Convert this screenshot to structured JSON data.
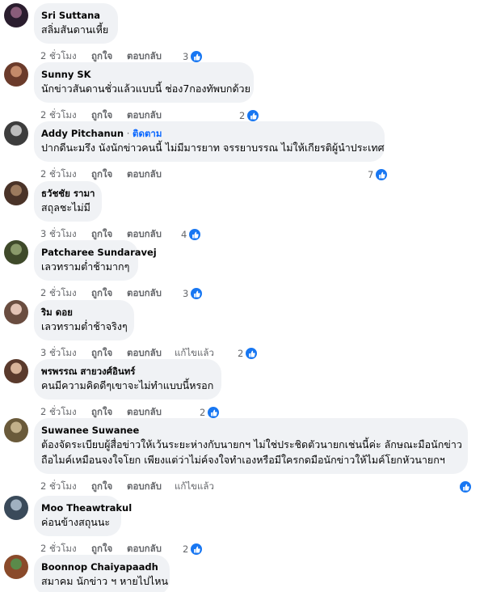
{
  "icons": {
    "like": "thumbs-up-icon"
  },
  "colors": {
    "bubble": "#f0f2f5",
    "accent": "#0866ff",
    "meta": "#65676b",
    "like": "#1877f2"
  },
  "comments": [
    {
      "author": "Sri Suttana",
      "text": [
        "สลิ่มสันดานเหี้ย"
      ],
      "time": "2 ชั่วโมง",
      "like": "ถูกใจ",
      "reply": "ตอบกลับ",
      "edited": "",
      "reactions": "3",
      "follow": ""
    },
    {
      "author": "Sunny SK",
      "text": [
        "นักข่าวสันดานชั่วแล้วแบบนี้ ช่อง7กองทัพบกด้วย"
      ],
      "time": "2 ชั่วโมง",
      "like": "ถูกใจ",
      "reply": "ตอบกลับ",
      "edited": "",
      "reactions": "2",
      "follow": ""
    },
    {
      "author": "Addy Pitchanun",
      "follow": "ติดตาม",
      "text": [
        "ปากดีนะมรึง นังนักข่าวคนนี้ ไม่มีมารยาท จรรยาบรรณ ไม่ให้เกียรติผู้นำประเทศ"
      ],
      "time": "2 ชั่วโมง",
      "like": "ถูกใจ",
      "reply": "ตอบกลับ",
      "edited": "",
      "reactions": "7"
    },
    {
      "author": "ธวัชชัย รามา",
      "text": [
        "สถุลชะไม่มี"
      ],
      "time": "3 ชั่วโมง",
      "like": "ถูกใจ",
      "reply": "ตอบกลับ",
      "edited": "",
      "reactions": "4",
      "follow": ""
    },
    {
      "author": "Patcharee Sundaravej",
      "text": [
        "เลวทรามต่ำช้ามากๆ"
      ],
      "time": "2 ชั่วโมง",
      "like": "ถูกใจ",
      "reply": "ตอบกลับ",
      "edited": "",
      "reactions": "3",
      "follow": ""
    },
    {
      "author": "ริม ดอย",
      "text": [
        "เลวทรามต่ำช้าจริงๆ"
      ],
      "time": "3 ชั่วโมง",
      "like": "ถูกใจ",
      "reply": "ตอบกลับ",
      "edited": "แก้ไขแล้ว",
      "reactions": "2",
      "follow": ""
    },
    {
      "author": "พรพรรณ สายวงศ์อินทร์",
      "text": [
        "คนมีความคิดดีๆเขาจะไม่ทำแบบนี้หรอก"
      ],
      "time": "2 ชั่วโมง",
      "like": "ถูกใจ",
      "reply": "ตอบกลับ",
      "edited": "",
      "reactions": "2",
      "follow": ""
    },
    {
      "author": "Suwanee Suwanee",
      "text": [
        "ต้องจัดระเบียบผู้สื่อข่าวให้เว้นระยะห่างกับนายกฯ ไม่ใช่ประชิดตัวนายกเช่นนี้ค่ะ ลักษณะมือนักข่าว",
        "ถือไมค์เหมือนจงใจโยก เพียงแต่ว่าไม่ค์จงใจทำเองหรือมีใครกดมือนักข่าวให้ไมค์โยกหัวนายกฯ"
      ],
      "time": "2 ชั่วโมง",
      "like": "ถูกใจ",
      "reply": "ตอบกลับ",
      "edited": "แก้ไขแล้ว",
      "reactions": "",
      "follow": ""
    },
    {
      "author": "Moo Theawtrakul",
      "text": [
        "ค่อนข้างสถุนนะ"
      ],
      "time": "2 ชั่วโมง",
      "like": "ถูกใจ",
      "reply": "ตอบกลับ",
      "edited": "",
      "reactions": "2",
      "follow": ""
    },
    {
      "author": "Boonnop Chaiyapaadh",
      "text": [
        "สมาคม นักข่าว ฯ หายไปไหน"
      ],
      "time": "",
      "like": "",
      "reply": "",
      "edited": "",
      "reactions": "",
      "follow": ""
    }
  ]
}
